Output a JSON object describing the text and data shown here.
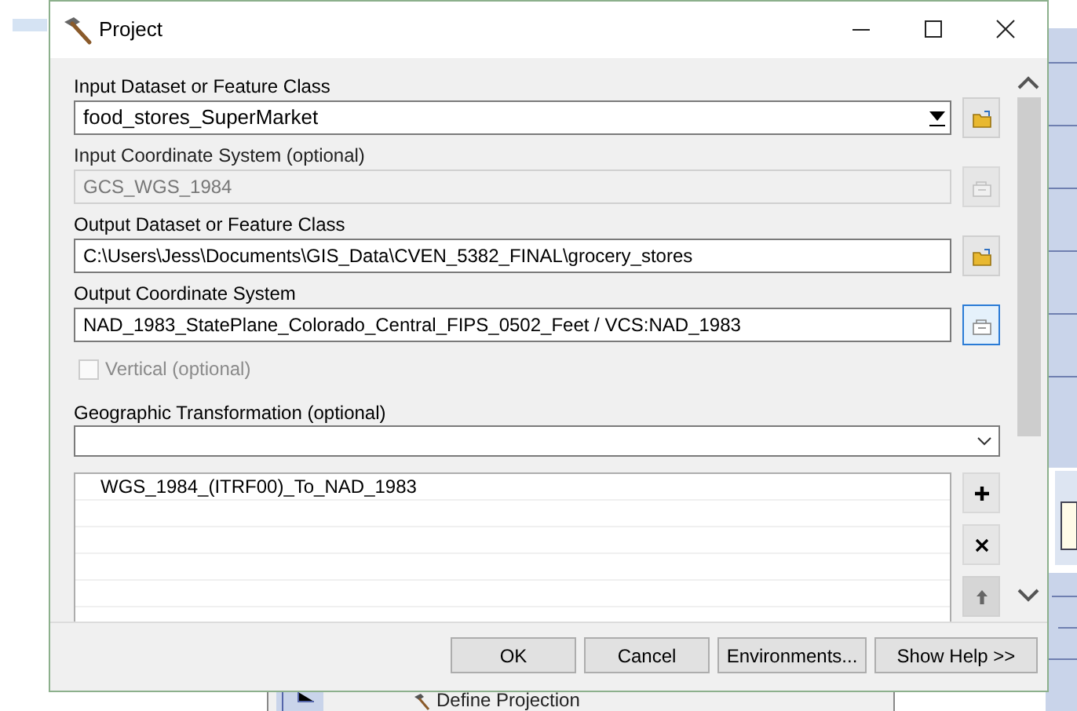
{
  "window": {
    "title": "Project"
  },
  "params": [
    {
      "kind": "combo",
      "label": "Input Dataset or Feature Class",
      "value": "food_stores_SuperMarket",
      "disabled": false,
      "highlighted": false
    },
    {
      "kind": "text",
      "label": "Input Coordinate System (optional)",
      "value": "GCS_WGS_1984",
      "disabled": true,
      "highlighted": false
    },
    {
      "kind": "text",
      "label": "Output Dataset or Feature Class",
      "value": "C:\\Users\\Jess\\Documents\\GIS_Data\\CVEN_5382_FINAL\\grocery_stores",
      "disabled": false,
      "highlighted": false
    },
    {
      "kind": "text",
      "label": "Output Coordinate System",
      "value": "NAD_1983_StatePlane_Colorado_Central_FIPS_0502_Feet / VCS:NAD_1983",
      "disabled": false,
      "highlighted": true
    }
  ],
  "vertical": {
    "label": "Vertical (optional)",
    "checked": false,
    "disabled": true
  },
  "transformation": {
    "label": "Geographic Transformation (optional)",
    "list": [
      "WGS_1984_(ITRF00)_To_NAD_1983"
    ]
  },
  "buttons": [
    "OK",
    "Cancel",
    "Environments...",
    "Show Help >>"
  ],
  "background": {
    "tool_label": "Define Projection"
  }
}
